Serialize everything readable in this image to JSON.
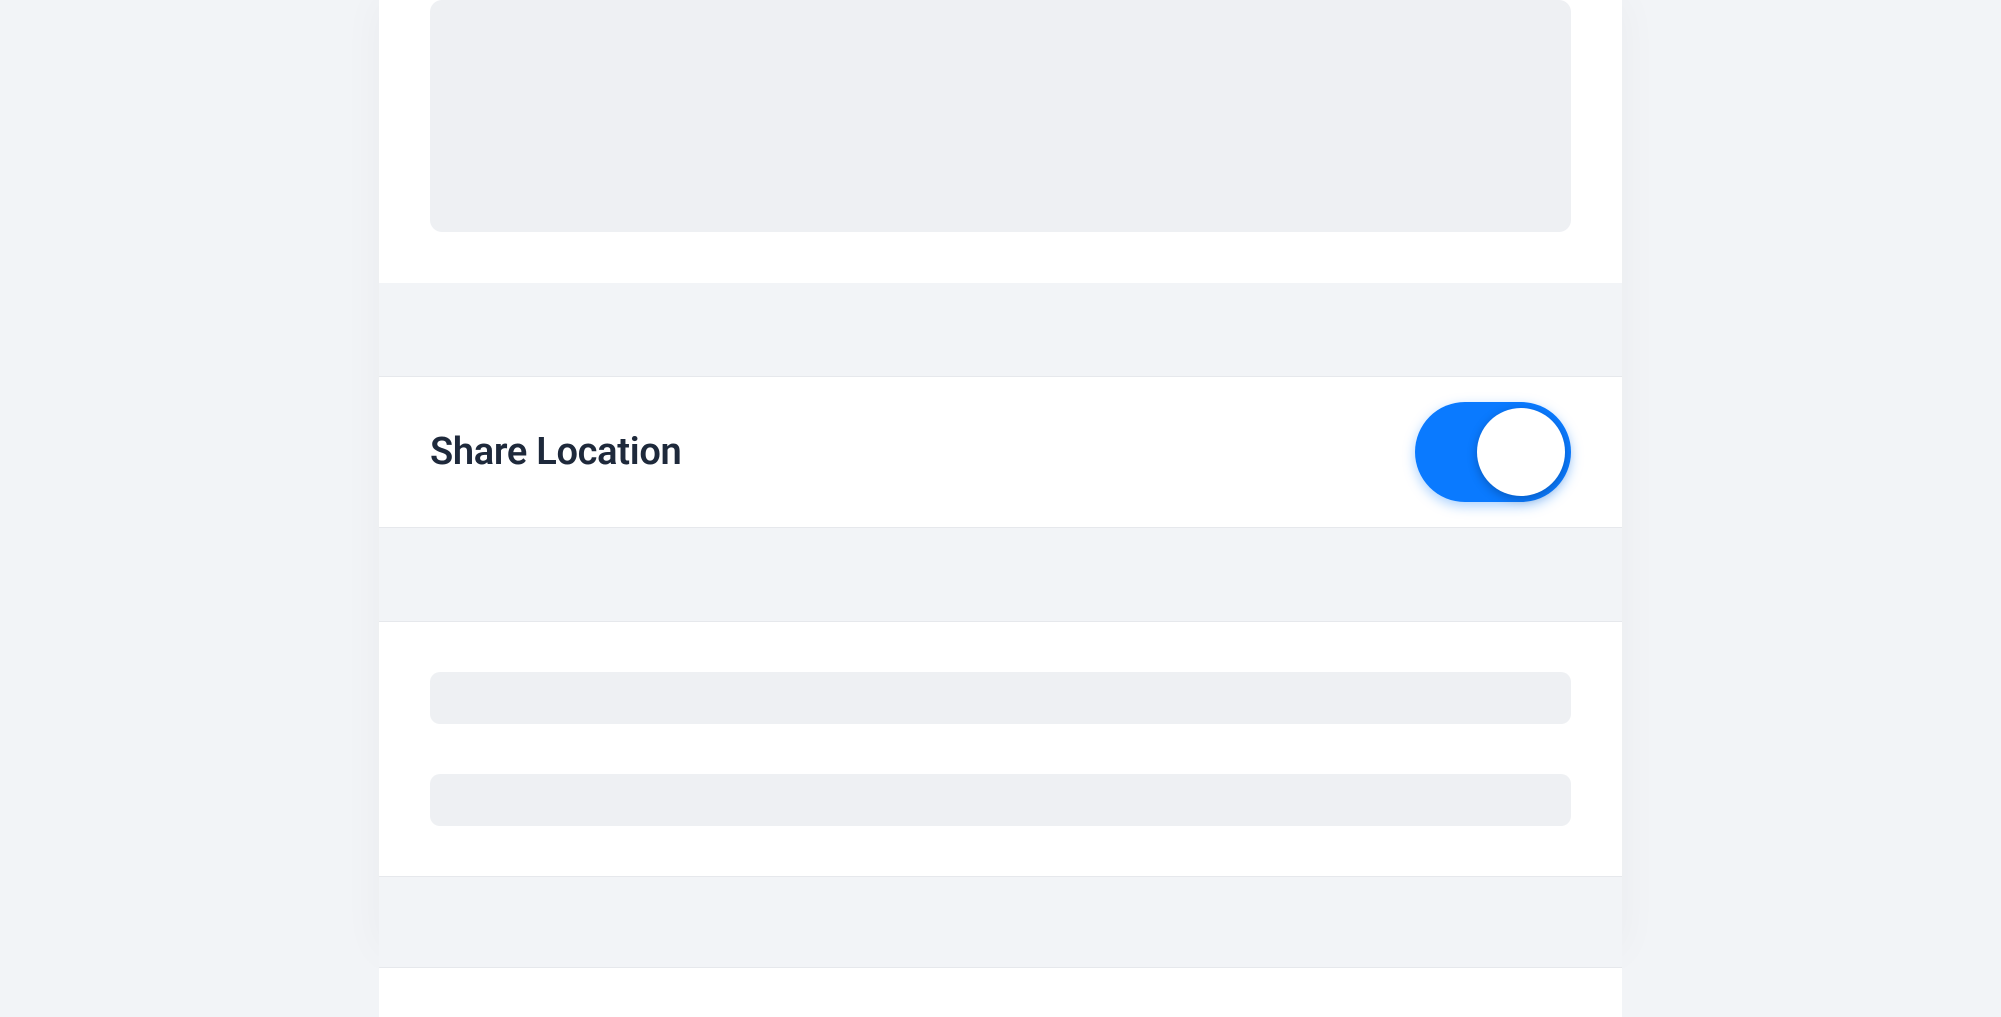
{
  "settings": {
    "shareLocation": {
      "label": "Share Location",
      "enabled": true
    }
  },
  "colors": {
    "toggleOn": "#0a7aff",
    "textPrimary": "#1e293b",
    "placeholder": "#eef0f3",
    "background": "#f2f4f7",
    "card": "#ffffff"
  }
}
